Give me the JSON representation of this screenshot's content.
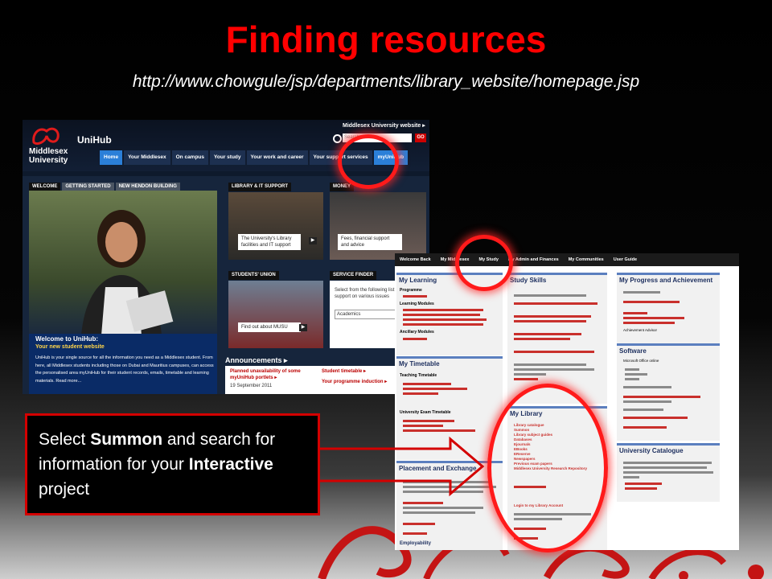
{
  "slide": {
    "title": "Finding resources",
    "url": "http://www.chowgule/jsp/departments/library_website/homepage.jsp"
  },
  "unihub": {
    "logo_line1": "Middlesex",
    "logo_line2": "University",
    "site_name": "UniHub",
    "top_link": "Middlesex University website ▸",
    "search_placeholder": "Search site:",
    "go_label": "GO",
    "nav": [
      "Home",
      "Your Middlesex",
      "On campus",
      "Your study",
      "Your work and career",
      "Your support services",
      "myUniHub"
    ],
    "hero_tabs": [
      "WELCOME",
      "GETTING STARTED",
      "NEW HENDON BUILDING"
    ],
    "hero_title": "Welcome to UniHub:",
    "hero_subtitle": "Your new student website",
    "hero_text": "UniHub is your single source for all the information you need as a Middlesex student. From here, all Middlesex students including those on Dubai and Mauritius campuses, can access the personalised area myUniHub for their student records, emails, timetable and learning materials. Read more...",
    "card_library_tab": "LIBRARY & IT SUPPORT",
    "card_library_caption": "The University's Library facilities and IT support",
    "card_money_tab": "MONEY",
    "card_money_caption": "Fees, financial support and advice",
    "card_union_tab": "STUDENTS' UNION",
    "card_union_caption": "Find out about MUSU",
    "card_service_tab": "SERVICE FINDER",
    "card_service_text": "Select from the following list to find support on various issues",
    "card_service_select": "Academics",
    "announcements_title": "Announcements ▸",
    "ann_item1": "Planned unavailability of some myUniHub portlets ▸",
    "ann_date": "19 September 2011",
    "ann_link1": "Student timetable ▸",
    "ann_link2": "Your programme induction ▸"
  },
  "myunihub": {
    "nav": [
      "Welcome Back",
      "My Middlesex",
      "My Study",
      "My Admin and Finances",
      "My Communities",
      "User Guide"
    ],
    "my_learning": "My Learning",
    "study_skills": "Study Skills",
    "progress": "My Progress and Achievement",
    "timetable": "My Timetable",
    "software": "Software",
    "library": "My Library",
    "placement": "Placement and Exchange",
    "catalogue": "University Catalogue",
    "employability": "Employability",
    "programme_label": "Programme",
    "learning_modules": "Learning Modules",
    "ancillary": "Ancillary Modules",
    "teaching_tt": "Teaching Timetable",
    "exam_tt": "University Exam Timetable",
    "achievement_advisor": "Achievement Advisor",
    "ms_office": "Microsoft Office online",
    "library_items": [
      "Library catalogue",
      "Summon",
      "Library subject guides",
      "Databases",
      "Ejournals",
      "EBooks",
      "EReserve",
      "Newspapers",
      "Previous exam papers",
      "Middlesex University Research Repository"
    ],
    "login_library": "Login to my Library Account"
  },
  "callout": {
    "part1": "Select ",
    "bold1": "Summon",
    "part2": " and search for  information  for your ",
    "bold2": "Interactive",
    "part3": " project"
  }
}
